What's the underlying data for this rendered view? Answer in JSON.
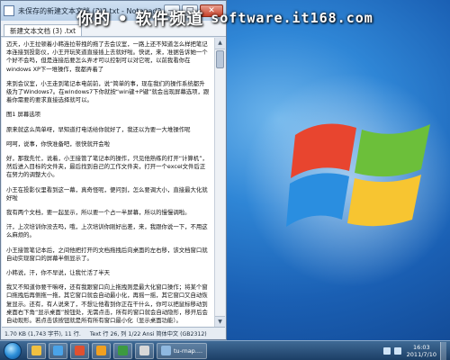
{
  "banner": {
    "text": "你的 • 软件频道",
    "url": "software.it168.com"
  },
  "window": {
    "title": "未保存的新建文本文档 (3)2.txt - Notepad2",
    "tab_label": "新建文本文档 (3) .txt",
    "controls": {
      "minimize": "—",
      "maximize": "□",
      "close": "✕"
    }
  },
  "editor": {
    "paragraphs": [
      "迈天，小王拉顿着小韩连拉带拽的拖了去会议室，一路上还不知道怎么样把笔记本连接到投影仪，小王开玩笑道直接插上去就好啦。快说，来，准据告诉她一个个好不会吗，但是连接后要怎么弄才可以控制可以对它呢，以前我看你在windows XP下一堆操作，我都弄着了",
      "来到会议室，小王走到笔记本电前前，说“简单的事，现在我们的操作系统都升级为了Windows7。在windows7下你就按“win键+P键”就会出现屏幕选项，跟着你需要的要求直接选择就可以。",
      "图1  屏幕选项",
      "原来就这么简单呀，早知道打电话给你就好了，我还以为要一大堆操作呢",
      "呵呵，说事，你快准备吧，很快就开会啦",
      "好，那我先忙，说着，小王接管了笔记本的操作，只见他熟练的打开“计算机”，然后进入目标的文件夹，最后找到自己的工作文件夹，打开一个excel文件后正在努力的调整大小。",
      "小王在投影仪里看到这一幕，真奇怪呢，便问到，怎么要调大小，直接最大化就好啦",
      "我有两个文档，要一起显示，所以要一个占一半屏幕，所以的慢慢调啦。",
      "汗，上次培训你没去吗，哦，上次培训你刚好出差，来，我跟你说一下，不用这么麻烦的。",
      "小王接管笔记本后，之间他把打开的文档拖拽后向桌面的左右移，该文档窗口就自动实现窗口的屏幕半侧显示了。",
      "小韩说，汗，你不早说，让我忙活了半天",
      "我又不知道你要干嘛呀，还有我跟窗口向上拖拽则是最大化窗口操作；将某个窗口拖拽后再侧拖一拖，其它窗口就会自动最小化，再摇一摇，其它窗口又自动恢复显示。还有，有人说来了，不想让他看到你正在干什么，你可以把鼠标移动到桌面右下角“显示桌面”按钮处，无需点击，所有的窗口就会自动隐形，移开后会自动现形。若点击该按钮就是所有所有窗口最小化（显示桌面功能）。"
    ]
  },
  "statusbar": {
    "size": "1.70 KB (1,743 字节), 11 行.",
    "position": "Text  行 26, 列 1/22  Ansi 简体中文 (GB2312)"
  },
  "taskbar": {
    "buttons": [
      {
        "label": "",
        "color": "#f0c040"
      },
      {
        "label": "",
        "color": "#4aa3e8"
      },
      {
        "label": "",
        "color": "#e05030"
      },
      {
        "label": "",
        "color": "#f0a020"
      },
      {
        "label": "",
        "color": "#3c9a40"
      },
      {
        "label": "",
        "color": "#d8d8d8"
      },
      {
        "label": "tu-rnap....",
        "color": "#8fb8e0"
      }
    ],
    "clock_time": "16:03",
    "clock_date": "2011/7/10"
  },
  "colors": {
    "accent": "#1f6fc0",
    "taskbar": "#1c3f66"
  }
}
